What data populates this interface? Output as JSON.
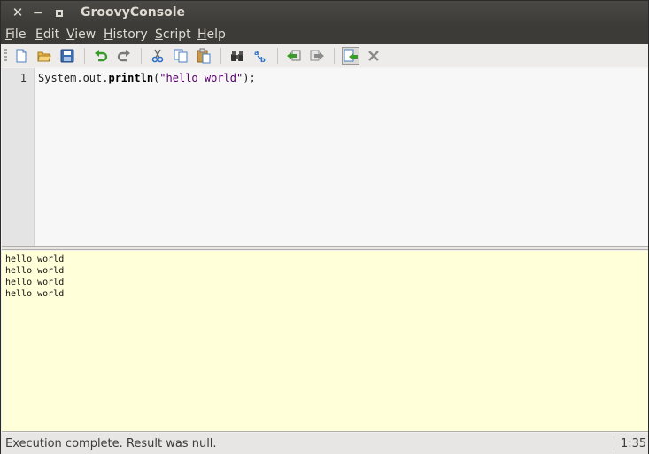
{
  "window": {
    "title": "GroovyConsole"
  },
  "menus": [
    {
      "label": "File",
      "mnemonic": "F",
      "rest": "ile"
    },
    {
      "label": "Edit",
      "mnemonic": "E",
      "rest": "dit"
    },
    {
      "label": "View",
      "mnemonic": "V",
      "rest": "iew"
    },
    {
      "label": "History",
      "mnemonic": "H",
      "rest": "istory"
    },
    {
      "label": "Script",
      "mnemonic": "S",
      "rest": "cript"
    },
    {
      "label": "Help",
      "mnemonic": "H",
      "rest": "elp"
    }
  ],
  "toolbar": {
    "icons": [
      "new-file-icon",
      "open-file-icon",
      "save-file-icon",
      "undo-icon",
      "redo-icon",
      "cut-icon",
      "copy-icon",
      "paste-icon",
      "find-icon",
      "replace-icon",
      "previous-history-icon",
      "next-history-icon",
      "run-script-icon",
      "interrupt-icon"
    ]
  },
  "editor": {
    "line_number": "1",
    "code_prefix": "System.out.",
    "code_method": "println",
    "code_open": "(",
    "code_string": "\"hello world\"",
    "code_close": ");"
  },
  "output": {
    "lines": [
      "hello world",
      "hello world",
      "hello world",
      "hello world"
    ],
    "background": "#ffffd9"
  },
  "status": {
    "message": "Execution complete. Result was null.",
    "caret_position": "1:35"
  },
  "colors": {
    "titlebar": "#3c3b37",
    "string_literal": "#56006b"
  }
}
